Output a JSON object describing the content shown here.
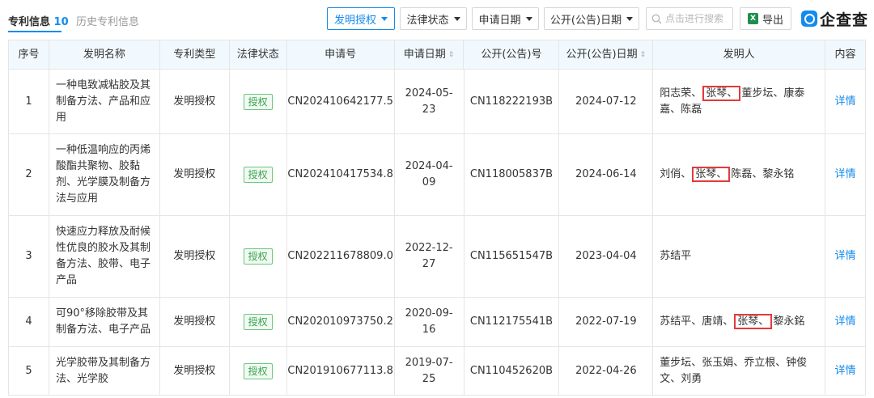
{
  "tabs": {
    "active_label": "专利信息",
    "active_count": "10",
    "history_label": "历史专利信息"
  },
  "filters": {
    "grant": "发明授权",
    "legal": "法律状态",
    "apply_date": "申请日期",
    "pub_date": "公开(公告)日期"
  },
  "search": {
    "placeholder": "点击进行搜索"
  },
  "export": {
    "label": "导出"
  },
  "brand": {
    "name": "企查查"
  },
  "colors": {
    "accent": "#128bed",
    "badge_green": "#3aa24f",
    "highlight_red": "#e33a3a",
    "header_bg": "#f2f9fe"
  },
  "table": {
    "headers": {
      "no": "序号",
      "name": "发明名称",
      "type": "专利类型",
      "status": "法律状态",
      "app_no": "申请号",
      "app_date": "申请日期",
      "pub_no": "公开(公告)号",
      "pub_date": "公开(公告)日期",
      "inventors": "发明人",
      "content": "内容"
    },
    "rows": [
      {
        "no": "1",
        "name": "一种电致减粘胶及其制备方法、产品和应用",
        "type": "发明授权",
        "status": "授权",
        "app_no": "CN202410642177.5",
        "app_date": "2024-05-23",
        "pub_no": "CN118222193B",
        "pub_date": "2024-07-12",
        "inv_before": "阳志荣、",
        "inv_highlight": "张琴、",
        "inv_after": "董步坛、康泰嘉、陈磊",
        "detail": "详情"
      },
      {
        "no": "2",
        "name": "一种低温响应的丙烯酸酯共聚物、胶黏剂、光学膜及制备方法与应用",
        "type": "发明授权",
        "status": "授权",
        "app_no": "CN202410417534.8",
        "app_date": "2024-04-09",
        "pub_no": "CN118005837B",
        "pub_date": "2024-06-14",
        "inv_before": "刘俏、",
        "inv_highlight": "张琴、",
        "inv_after": "陈磊、黎永铭",
        "detail": "详情"
      },
      {
        "no": "3",
        "name": "快速应力释放及耐候性优良的胶水及其制备方法、胶带、电子产品",
        "type": "发明授权",
        "status": "授权",
        "app_no": "CN202211678809.0",
        "app_date": "2022-12-27",
        "pub_no": "CN115651547B",
        "pub_date": "2023-04-04",
        "inv_before": "苏结平",
        "inv_highlight": "",
        "inv_after": "",
        "detail": "详情"
      },
      {
        "no": "4",
        "name": "可90°移除胶带及其制备方法、电子产品",
        "type": "发明授权",
        "status": "授权",
        "app_no": "CN202010973750.2",
        "app_date": "2020-09-16",
        "pub_no": "CN112175541B",
        "pub_date": "2022-07-19",
        "inv_before": "苏结平、唐靖、",
        "inv_highlight": "张琴、",
        "inv_after": "黎永銘",
        "detail": "详情"
      },
      {
        "no": "5",
        "name": "光学胶带及其制备方法、光学胶",
        "type": "发明授权",
        "status": "授权",
        "app_no": "CN201910677113.8",
        "app_date": "2019-07-25",
        "pub_no": "CN110452620B",
        "pub_date": "2022-04-26",
        "inv_before": "董步坛、张玉娟、乔立根、钟俊文、刘勇",
        "inv_highlight": "",
        "inv_after": "",
        "detail": "详情"
      }
    ]
  }
}
